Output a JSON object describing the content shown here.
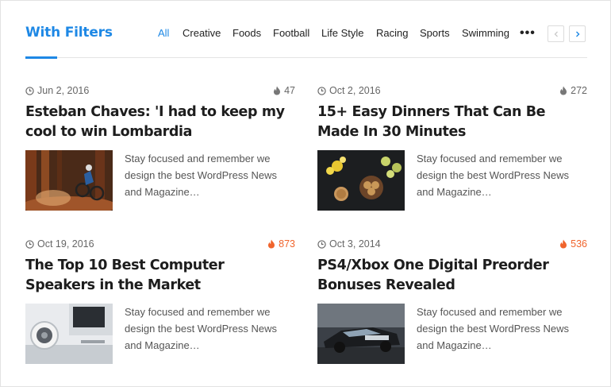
{
  "block": {
    "title": "With Filters",
    "filters": [
      {
        "label": "All",
        "active": true
      },
      {
        "label": "Creative",
        "active": false
      },
      {
        "label": "Foods",
        "active": false
      },
      {
        "label": "Football",
        "active": false
      },
      {
        "label": "Life Style",
        "active": false
      },
      {
        "label": "Racing",
        "active": false
      },
      {
        "label": "Sports",
        "active": false
      },
      {
        "label": "Swimming",
        "active": false
      }
    ],
    "more_label": "•••",
    "accent_color": "#1e88e5",
    "hot_color": "#f0642c"
  },
  "posts": [
    {
      "date": "Jun 2, 2016",
      "views": "47",
      "hot": false,
      "title": "Esteban Chaves: 'I had to keep my cool to win Lombardia",
      "excerpt": "Stay focused and remember we design the best WordPress News and Magazine…",
      "image": "mountain-biker-forest"
    },
    {
      "date": "Oct 2, 2016",
      "views": "272",
      "hot": false,
      "title": "15+ Easy Dinners That Can Be Made In 30 Minutes",
      "excerpt": "Stay focused and remember we design the best WordPress News and Magazine…",
      "image": "cookies-and-flowers"
    },
    {
      "date": "Oct 19, 2016",
      "views": "873",
      "hot": true,
      "title": "The Top 10 Best Computer Speakers in the Market",
      "excerpt": "Stay focused and remember we design the best WordPress News and Magazine…",
      "image": "speaker-desk"
    },
    {
      "date": "Oct 3, 2014",
      "views": "536",
      "hot": true,
      "title": "PS4/Xbox One Digital Preorder Bonuses Revealed",
      "excerpt": "Stay focused and remember we design the best WordPress News and Magazine…",
      "image": "racing-car"
    }
  ]
}
